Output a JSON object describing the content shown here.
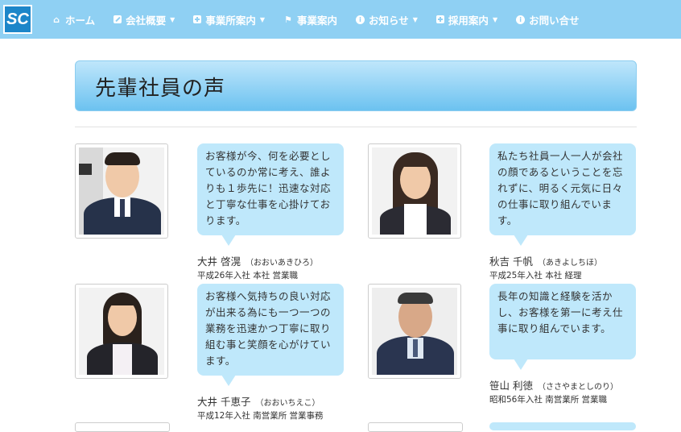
{
  "logo": {
    "text": "SC"
  },
  "nav": {
    "items": [
      {
        "label": "ホーム",
        "icon": "home-icon",
        "dropdown": false
      },
      {
        "label": "会社概要",
        "icon": "edit-icon",
        "dropdown": true
      },
      {
        "label": "事業所案内",
        "icon": "plus-square-icon",
        "dropdown": true
      },
      {
        "label": "事業案内",
        "icon": "flag-icon",
        "dropdown": false
      },
      {
        "label": "お知らせ",
        "icon": "info-circle-icon",
        "dropdown": true
      },
      {
        "label": "採用案内",
        "icon": "plus-square-icon",
        "dropdown": true
      },
      {
        "label": "お問い合せ",
        "icon": "info-circle-icon",
        "dropdown": false
      }
    ]
  },
  "page": {
    "title": "先輩社員の声"
  },
  "employees": [
    {
      "message": "お客様が今、何を必要としているのか常に考え、誰よりも１歩先に！迅速な対応と丁寧な仕事を心掛けております。",
      "name": "大井 啓滉",
      "kana": "（おおいあきひろ）",
      "info": "平成26年入社 本社 営業職"
    },
    {
      "message": "私たち社員一人一人が会社の顔であるということを忘れずに、明るく元気に日々の仕事に取り組んでいます。",
      "name": "秋吉 千帆",
      "kana": "（あきよしちほ）",
      "info": "平成25年入社 本社 経理"
    },
    {
      "message": "お客様へ気持ちの良い対応が出来る為にも一つ一つの業務を迅速かつ丁寧に取り組む事と笑顔を心がけています。",
      "name": "大井 千恵子",
      "kana": "（おおいちえこ）",
      "info": "平成12年入社 南営業所 営業事務"
    },
    {
      "message": "長年の知識と経験を活かし、お客様を第一に考え仕事に取り組んでいます。",
      "name": "笹山 利徳",
      "kana": "（ささやまとしのり）",
      "info": "昭和56年入社 南営業所 営業職"
    }
  ],
  "colors": {
    "nav": "#8fd0f3",
    "bubble": "#bfe8fb",
    "heading_top": "#bfe6fb",
    "heading_bottom": "#6cc2f0"
  }
}
